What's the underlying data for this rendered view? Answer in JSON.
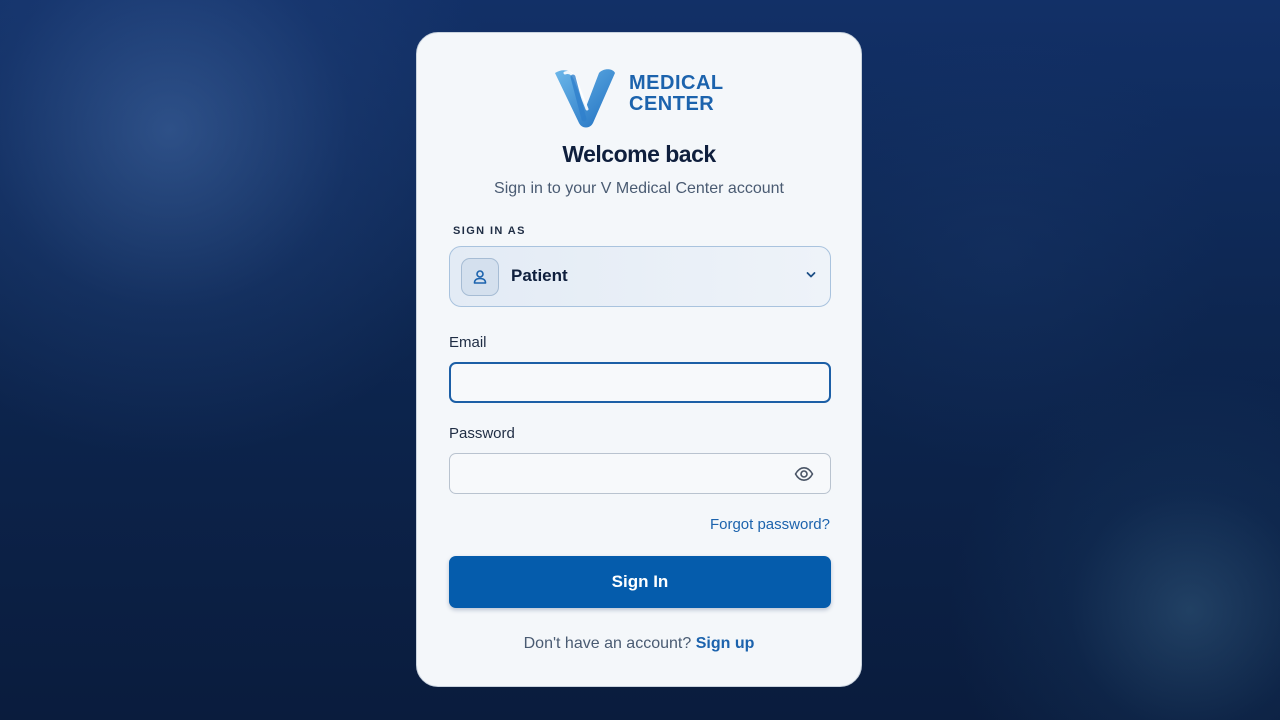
{
  "brand": {
    "logo_line1": "MEDICAL",
    "logo_line2": "CENTER",
    "logo_icon": "v-logo-icon",
    "color": "#1c63ad"
  },
  "header": {
    "title": "Welcome back",
    "subtitle": "Sign in to your V Medical Center account"
  },
  "role": {
    "label": "SIGN IN AS",
    "selected": "Patient",
    "icon": "user-icon",
    "chevron_icon": "chevron-down-icon"
  },
  "email": {
    "label": "Email",
    "value": "",
    "placeholder": ""
  },
  "password": {
    "label": "Password",
    "value": "",
    "placeholder": "",
    "toggle_icon": "eye-icon"
  },
  "forgot_password": "Forgot password?",
  "submit_label": "Sign In",
  "signup": {
    "prompt": "Don't have an account?",
    "link": "Sign up"
  },
  "colors": {
    "primary": "#055cac",
    "link": "#1c63ad",
    "heading": "#0f1f3d",
    "background": "#0d2650"
  }
}
